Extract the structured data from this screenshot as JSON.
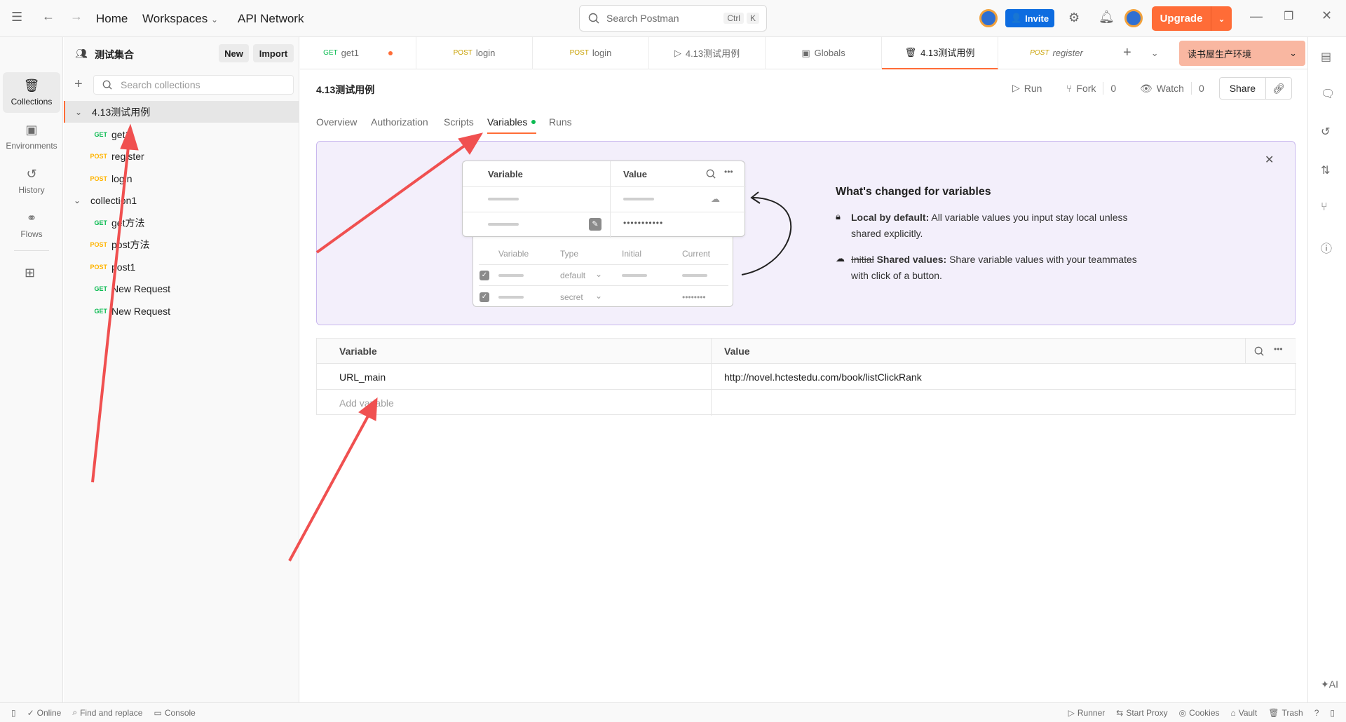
{
  "topbar": {
    "nav_home": "Home",
    "nav_workspaces": "Workspaces",
    "nav_api_network": "API Network",
    "search_placeholder": "Search Postman",
    "kbd_ctrl": "Ctrl",
    "kbd_k": "K",
    "invite_label": "Invite",
    "upgrade_label": "Upgrade"
  },
  "rail": {
    "items": [
      {
        "label": "Collections",
        "icon": "collections-icon"
      },
      {
        "label": "Environments",
        "icon": "environments-icon"
      },
      {
        "label": "History",
        "icon": "history-icon"
      },
      {
        "label": "Flows",
        "icon": "flows-icon"
      }
    ]
  },
  "sidebar": {
    "workspace_name": "测试集合",
    "new_label": "New",
    "import_label": "Import",
    "search_placeholder": "Search collections",
    "tree": [
      {
        "type": "collection",
        "label": "4.13测试用例"
      },
      {
        "type": "request",
        "method": "GET",
        "label": "get1"
      },
      {
        "type": "request",
        "method": "POST",
        "label": "register"
      },
      {
        "type": "request",
        "method": "POST",
        "label": "login"
      },
      {
        "type": "collection",
        "label": "collection1"
      },
      {
        "type": "request",
        "method": "GET",
        "label": "get方法"
      },
      {
        "type": "request",
        "method": "POST",
        "label": "post方法"
      },
      {
        "type": "request",
        "method": "POST",
        "label": "post1"
      },
      {
        "type": "request",
        "method": "GET",
        "label": "New Request"
      },
      {
        "type": "request",
        "method": "GET",
        "label": "New Request"
      }
    ]
  },
  "tabs": [
    {
      "method": "GET",
      "label": "get1"
    },
    {
      "method": "POST",
      "label": "login"
    },
    {
      "method": "POST",
      "label": "login"
    },
    {
      "method": "",
      "label": "4.13测试用例"
    },
    {
      "method": "",
      "label": "Globals"
    },
    {
      "method": "",
      "label": "4.13测试用例"
    },
    {
      "method": "POST",
      "label": "register"
    }
  ],
  "environment": "读书屋生产环境",
  "main": {
    "title": "4.13测试用例",
    "run_label": "Run",
    "fork_label": "Fork",
    "fork_count": "0",
    "watch_label": "Watch",
    "watch_count": "0",
    "share_label": "Share",
    "subtabs": [
      "Overview",
      "Authorization",
      "Scripts",
      "Variables",
      "Runs"
    ]
  },
  "banner": {
    "card_header_variable": "Variable",
    "card_header_value": "Value",
    "card_dots": "•••••••••••",
    "table_headers": [
      "Variable",
      "Type",
      "Initial",
      "Current"
    ],
    "type_default": "default",
    "type_secret": "secret",
    "current_dots": "••••••••",
    "heading": "What's changed for variables",
    "local_title": "Local by default:",
    "local_text": "All variable values you input stay local unless shared explicitly.",
    "initial_strike": "Initial",
    "shared_title": "Shared values:",
    "shared_text": "Share variable values with your teammates with click of a button."
  },
  "vartable": {
    "header_variable": "Variable",
    "header_value": "Value",
    "rows": [
      {
        "variable": "URL_main",
        "value": "http://novel.hctestedu.com/book/listClickRank"
      }
    ],
    "add_placeholder": "Add variable"
  },
  "statusbar": {
    "online": "Online",
    "find_replace": "Find and replace",
    "console": "Console",
    "runner": "Runner",
    "start_proxy": "Start Proxy",
    "cookies": "Cookies",
    "vault": "Vault",
    "trash": "Trash"
  },
  "colors": {
    "accent": "#ff6c37",
    "invite": "#0d6ce0",
    "get": "#0cbb52",
    "post": "#ffb400",
    "annotation_arrow": "#f05050"
  }
}
